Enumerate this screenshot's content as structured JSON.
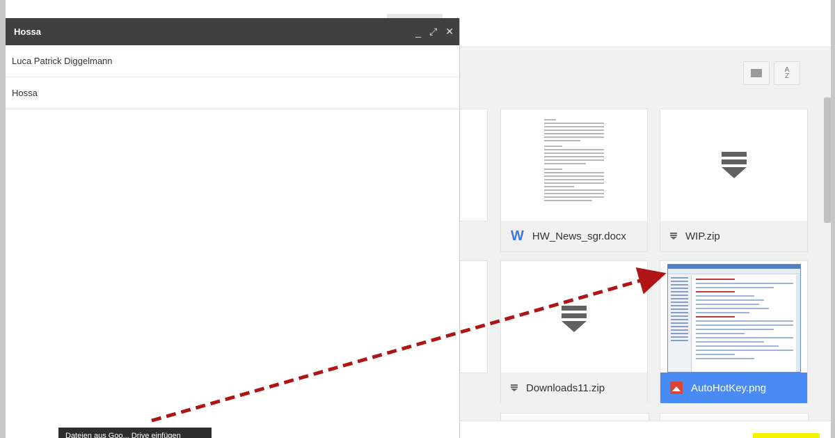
{
  "compose": {
    "title": "Hossa",
    "recipient": "Luca Patrick Diggelmann",
    "subject": "Hossa",
    "controls": {
      "minimize": "_",
      "expand": "⤢",
      "close": "✕"
    }
  },
  "drive": {
    "sort_label_top": "A",
    "sort_label_bottom": "Z",
    "files": [
      {
        "name": "HW_News_sgr.docx",
        "icon": "word-doc-icon"
      },
      {
        "name": "WIP.zip",
        "icon": "zip-icon"
      },
      {
        "name": "Downloads11.zip",
        "icon": "zip-icon"
      },
      {
        "name": "AutoHotKey.png",
        "icon": "image-icon",
        "selected": true
      }
    ]
  },
  "tooltip": {
    "text": "Dateien aus Goo... Drive einfügen"
  },
  "colors": {
    "compose_header": "#404040",
    "selection": "#4a8af4",
    "arrow": "#b01515"
  }
}
